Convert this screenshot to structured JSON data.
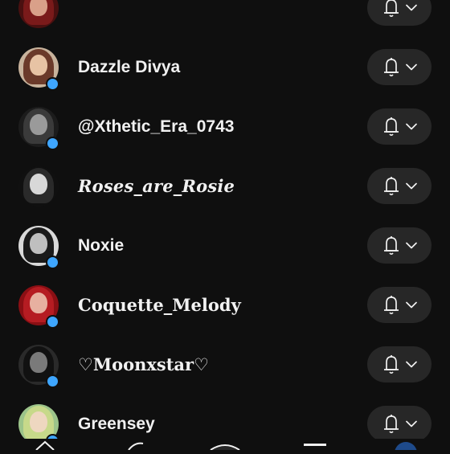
{
  "channels": [
    {
      "name": "",
      "hasDot": false,
      "style": "normal",
      "avatar": {
        "bg": "#4a1010",
        "hair": "#7a1a1a",
        "face": "#d9a089"
      }
    },
    {
      "name": "Dazzle Divya",
      "hasDot": true,
      "style": "normal",
      "avatar": {
        "bg": "#c8b39c",
        "hair": "#6b3a2a",
        "face": "#e7c3a4"
      }
    },
    {
      "name": "@Xthetic_Era_0743",
      "hasDot": true,
      "style": "normal",
      "avatar": {
        "bg": "#1c1c1c",
        "hair": "#3a3a3a",
        "face": "#9a9a9a"
      }
    },
    {
      "name": "Roses_are_Rosie",
      "hasDot": false,
      "style": "fancy",
      "avatar": {
        "bg": "#101010",
        "hair": "#2a2a2a",
        "face": "#d8d8d8"
      }
    },
    {
      "name": "Noxie",
      "hasDot": true,
      "style": "normal",
      "avatar": {
        "bg": "#d9d9d9",
        "hair": "#1a1a1a",
        "face": "#bfbfbf"
      }
    },
    {
      "name": "Coquette_Melody",
      "hasDot": true,
      "style": "goth",
      "avatar": {
        "bg": "#8a0f14",
        "hair": "#b51c22",
        "face": "#e7b0a0"
      }
    },
    {
      "name": "♡Moonxstar♡",
      "hasDot": true,
      "style": "goth",
      "avatar": {
        "bg": "#2a2a2a",
        "hair": "#111111",
        "face": "#7a7a7a"
      }
    },
    {
      "name": "Greensey",
      "hasDot": true,
      "style": "normal",
      "avatar": {
        "bg": "#9cc48a",
        "hair": "#c7d98a",
        "face": "#eed7c0"
      }
    }
  ],
  "notify_icon": "bell-icon",
  "dropdown_icon": "chevron-down-icon",
  "nav_icons": [
    "home-icon",
    "shorts-icon",
    "create-icon",
    "subscriptions-icon",
    "you-icon"
  ],
  "colors": {
    "background": "#0f0f0f",
    "button": "#272727",
    "text": "#f1f1f1",
    "live_dot": "#3ea6ff"
  }
}
